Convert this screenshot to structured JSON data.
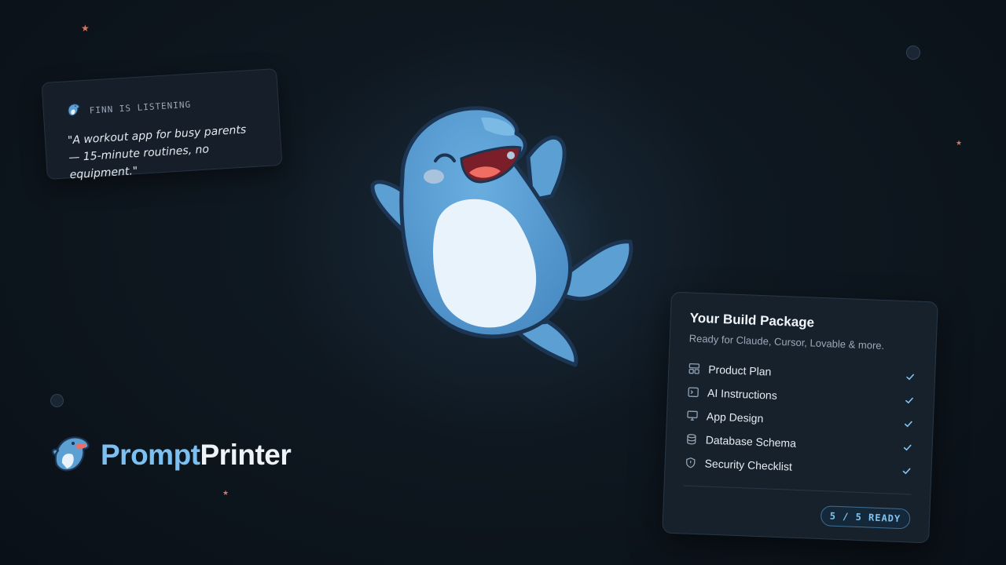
{
  "listening_card": {
    "label": "FINN IS LISTENING",
    "quote": "\"A workout app for busy parents — 15-minute routines, no equipment.\""
  },
  "brand": {
    "name_part1": "Prompt",
    "name_part2": "Printer"
  },
  "package_card": {
    "title": "Your Build Package",
    "subtitle": "Ready for Claude, Cursor, Lovable & more.",
    "items": [
      {
        "label": "Product Plan",
        "icon": "layout-icon"
      },
      {
        "label": "AI Instructions",
        "icon": "terminal-icon"
      },
      {
        "label": "App Design",
        "icon": "monitor-icon"
      },
      {
        "label": "Database Schema",
        "icon": "database-icon"
      },
      {
        "label": "Security Checklist",
        "icon": "shield-icon"
      }
    ],
    "status": "5 / 5 READY"
  },
  "colors": {
    "background": "#0c131b",
    "accent_blue": "#7cc0f1",
    "star_coral": "#d9775f",
    "card": "#17212c"
  }
}
